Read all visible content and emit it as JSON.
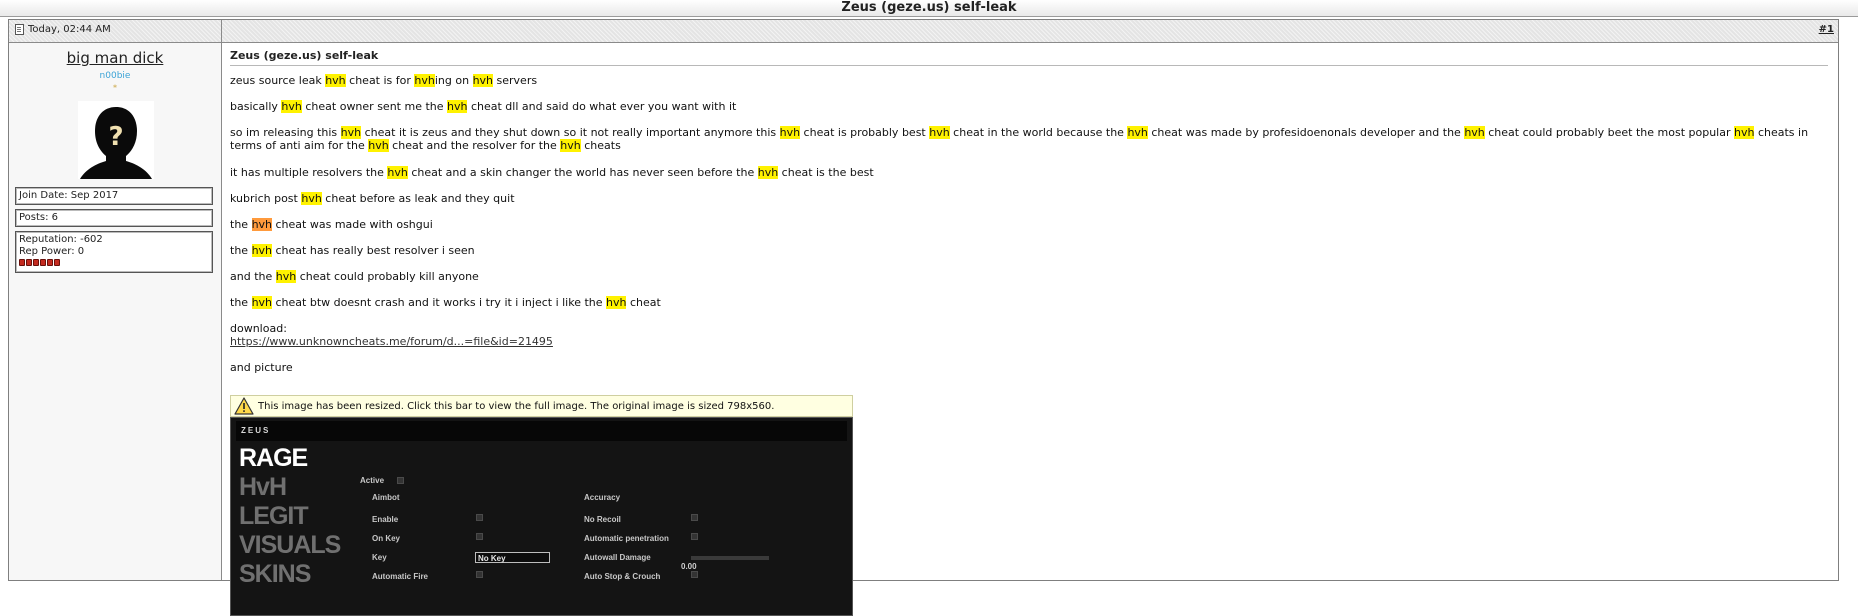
{
  "thread_title": "Zeus (geze.us) self-leak",
  "post": {
    "date": "Today, 02:44 AM",
    "number": "#1",
    "title": "Zeus (geze.us) self-leak"
  },
  "user": {
    "name": "big man dick",
    "title": "n00bie",
    "stars": "⁎",
    "avatar_mark": "?",
    "join_date": "Join Date: Sep 2017",
    "posts": "Posts: 6",
    "reputation": "Reputation: -602",
    "rep_power": "Rep Power: 0",
    "rep_dots": 6
  },
  "body": {
    "p1": [
      "zeus source leak ",
      "hvh",
      " cheat is for ",
      "hvh",
      "ing on ",
      "hvh",
      " servers"
    ],
    "p2": [
      "basically ",
      "hvh",
      " cheat owner sent me the ",
      "hvh",
      " cheat dll and said do what ever you want with it"
    ],
    "p3": [
      "so im releasing this ",
      "hvh",
      " cheat it is zeus and they shut down so it not really important anymore this ",
      "hvh",
      " cheat is probably best ",
      "hvh",
      " cheat in the world because the ",
      "hvh",
      " cheat was made by profesidoenonals developer and the ",
      "hvh",
      " cheat could probably beet the most popular ",
      "hvh",
      " cheats in terms of anti aim for the ",
      "hvh",
      " cheat and the resolver for the ",
      "hvh",
      " cheats"
    ],
    "p4": [
      "it has multiple resolvers the ",
      "hvh",
      " cheat and a skin changer the world has never seen before the ",
      "hvh",
      " cheat is the best"
    ],
    "p5": [
      "kubrich post ",
      "hvh",
      " cheat before as leak and they quit"
    ],
    "p6": [
      "the ",
      "hvh",
      " cheat was made with oshgui"
    ],
    "p7": [
      "the ",
      "hvh",
      " cheat has really best resolver i seen"
    ],
    "p8": [
      "and the ",
      "hvh",
      " cheat could probably kill anyone"
    ],
    "p9": [
      "the ",
      "hvh",
      " cheat btw doesnt crash and it works i try it i inject i like the ",
      "hvh",
      " cheat"
    ],
    "download_label": "download:",
    "download_link": "https://www.unknowncheats.me/forum/d...=file&id=21495",
    "picture_label": "and picture",
    "resize_notice": "This image has been resized. Click this bar to view the full image. The original image is sized 798x560."
  },
  "screenshot": {
    "brand": "ZEUS",
    "nav": [
      "RAGE",
      "HvH",
      "LEGIT",
      "VISUALS",
      "SKINS"
    ],
    "active_nav": "RAGE",
    "active_label": "Active",
    "aimbot_header": "Aimbot",
    "accuracy_header": "Accuracy",
    "left_options": [
      "Enable",
      "On Key",
      "Key",
      "Automatic Fire"
    ],
    "right_options": [
      "No Recoil",
      "Automatic penetration",
      "Autowall Damage",
      "Auto Stop & Crouch"
    ],
    "key_value": "No Key",
    "autowall_value": "0.00"
  },
  "colors": {
    "highlight": "#fff200",
    "highlight_active": "#ff9a3c",
    "user_title": "#3ba3d6",
    "rep_dot": "#c42a1f"
  }
}
